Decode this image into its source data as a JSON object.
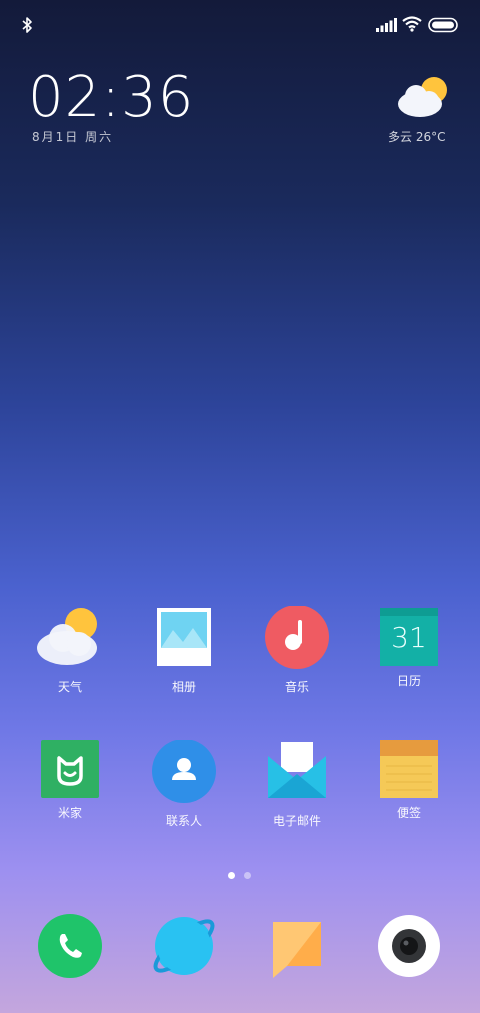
{
  "status_bar": {
    "icons": [
      "bluetooth-icon",
      "signal-icon",
      "wifi-icon",
      "battery-icon"
    ]
  },
  "clock": {
    "time": "02:36",
    "date": "8月1日 周六"
  },
  "weather_widget": {
    "icon": "partly-cloudy-icon",
    "text": "多云 26°C"
  },
  "home_apps": [
    {
      "label": "天气",
      "icon": "weather-icon"
    },
    {
      "label": "相册",
      "icon": "gallery-icon"
    },
    {
      "label": "音乐",
      "icon": "music-icon"
    },
    {
      "label": "日历",
      "icon": "calendar-icon",
      "badge_text": "31"
    },
    {
      "label": "米家",
      "icon": "mijia-icon"
    },
    {
      "label": "联系人",
      "icon": "contacts-icon"
    },
    {
      "label": "电子邮件",
      "icon": "email-icon"
    },
    {
      "label": "便签",
      "icon": "notes-icon"
    }
  ],
  "page_indicator": {
    "pages": 2,
    "current": 1
  },
  "dock": [
    {
      "icon": "phone-icon"
    },
    {
      "icon": "browser-icon"
    },
    {
      "icon": "messages-icon"
    },
    {
      "icon": "camera-icon"
    }
  ],
  "colors": {
    "phone": "#1fc46a",
    "browser": "#29c2f2",
    "messages": "#ffb75c",
    "music": "#ef5b62",
    "calendar": "#13b0a6",
    "mijia": "#2fb063",
    "contacts": "#2f8fe8",
    "email": "#27c0e6",
    "notes": "#f5c957"
  }
}
